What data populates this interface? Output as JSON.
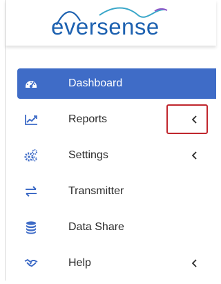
{
  "brand": {
    "logo_text": "eversense",
    "colors": {
      "primary": "#1d61b0",
      "swoosh": "#3aa7c9",
      "swoosh_accent": "#8f57c8"
    }
  },
  "nav": {
    "items": [
      {
        "label": "Dashboard",
        "icon": "dashboard-icon",
        "active": true,
        "has_chevron": false
      },
      {
        "label": "Reports",
        "icon": "chart-line-icon",
        "active": false,
        "has_chevron": true
      },
      {
        "label": "Settings",
        "icon": "gears-icon",
        "active": false,
        "has_chevron": true
      },
      {
        "label": "Transmitter",
        "icon": "transfer-arrows-icon",
        "active": false,
        "has_chevron": false
      },
      {
        "label": "Data Share",
        "icon": "database-icon",
        "active": false,
        "has_chevron": false
      },
      {
        "label": "Help",
        "icon": "handshake-icon",
        "active": false,
        "has_chevron": true
      }
    ],
    "colors": {
      "active_bg": "#3f6cc7",
      "icon": "#3f6cc7",
      "text": "#2b2b2b",
      "highlight_box": "#c0262d"
    }
  }
}
